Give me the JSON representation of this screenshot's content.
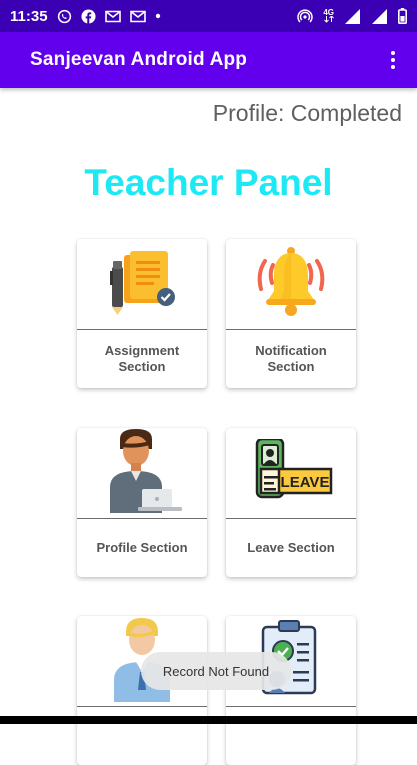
{
  "status_bar": {
    "time": "11:35",
    "left_icons": [
      "whatsapp-icon",
      "facebook-icon",
      "gmail-icon",
      "gmail-icon",
      "more-dot-icon"
    ],
    "network": "4G",
    "right_icons": [
      "hotspot-icon",
      "network-4g-icon",
      "signal-icon",
      "signal-icon",
      "battery-icon"
    ]
  },
  "app_bar": {
    "title": "Sanjeevan Android App",
    "menu_icon": "overflow-menu-icon"
  },
  "profile_status": "Profile: Completed",
  "panel_title": "Teacher Panel",
  "cards": [
    {
      "label": "Assignment Section",
      "icon": "assignment-icon"
    },
    {
      "label": "Notification Section",
      "icon": "bell-icon"
    },
    {
      "label": "Profile Section",
      "icon": "profile-icon"
    },
    {
      "label": "Leave Section",
      "icon": "leave-icon"
    },
    {
      "label": "",
      "icon": "teacher-icon"
    },
    {
      "label": "",
      "icon": "checklist-icon"
    }
  ],
  "toast": "Record Not Found",
  "colors": {
    "status_bar": "#3b00b3",
    "app_bar": "#6200ee",
    "panel_title": "#1de9f5"
  }
}
